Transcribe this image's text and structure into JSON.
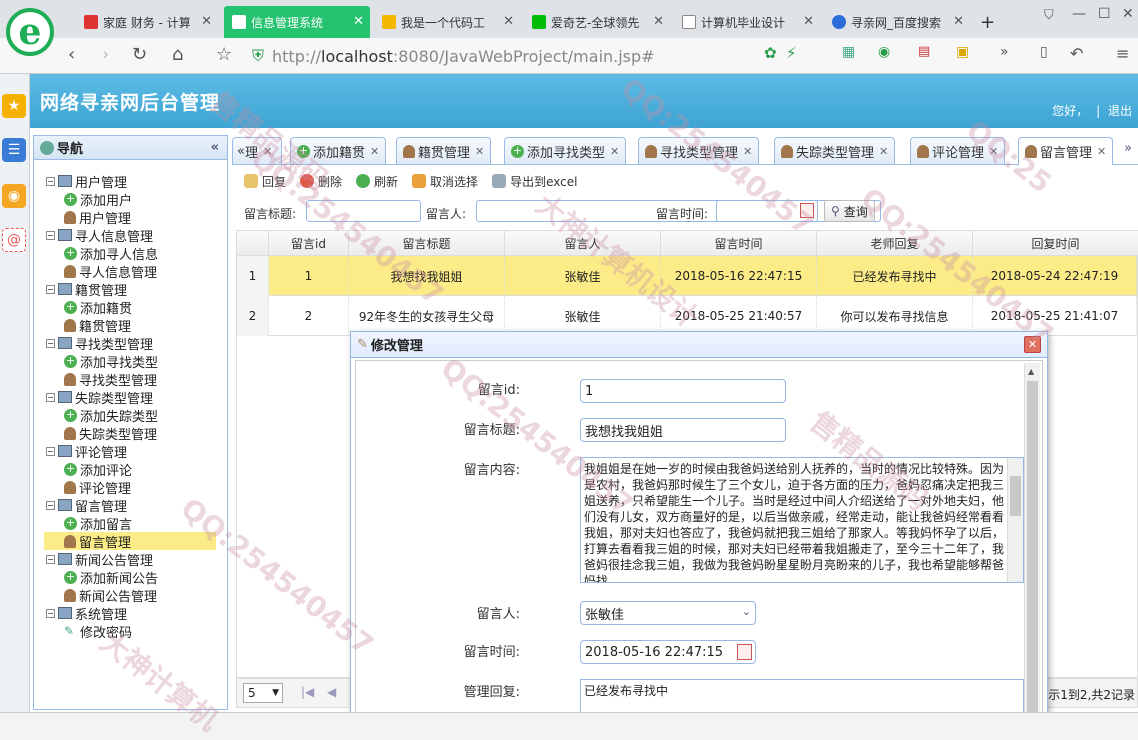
{
  "browser": {
    "tabs": [
      {
        "label": "家庭 财务 - 计算",
        "color": "#d33"
      },
      {
        "label": "信息管理系统",
        "color": "#fff"
      },
      {
        "label": "我是一个代码工",
        "color": "#f5b800"
      },
      {
        "label": "爱奇艺-全球领先",
        "color": "#00be06"
      },
      {
        "label": "计算机毕业设计",
        "color": "#888"
      },
      {
        "label": "寻亲网_百度搜索",
        "color": "#2a6dd8"
      }
    ],
    "new_tab": "+",
    "url_prefix": "http://",
    "url_host": "localhost",
    "url_rest": ":8080/JavaWebProject/main.jsp#"
  },
  "app": {
    "title": "网络寻亲网后台管理",
    "welcome": "您好，",
    "logout": "退出",
    "separator": "|"
  },
  "nav": {
    "title": "导航",
    "collapse": "«",
    "items": [
      {
        "label": "用户管理",
        "type": "folder"
      },
      {
        "label": "添加用户",
        "type": "add"
      },
      {
        "label": "用户管理",
        "type": "user"
      },
      {
        "label": "寻人信息管理",
        "type": "folder"
      },
      {
        "label": "添加寻人信息",
        "type": "add"
      },
      {
        "label": "寻人信息管理",
        "type": "user"
      },
      {
        "label": "籍贯管理",
        "type": "folder"
      },
      {
        "label": "添加籍贯",
        "type": "add"
      },
      {
        "label": "籍贯管理",
        "type": "user"
      },
      {
        "label": "寻找类型管理",
        "type": "folder"
      },
      {
        "label": "添加寻找类型",
        "type": "add"
      },
      {
        "label": "寻找类型管理",
        "type": "user"
      },
      {
        "label": "失踪类型管理",
        "type": "folder"
      },
      {
        "label": "添加失踪类型",
        "type": "add"
      },
      {
        "label": "失踪类型管理",
        "type": "user"
      },
      {
        "label": "评论管理",
        "type": "folder"
      },
      {
        "label": "添加评论",
        "type": "add"
      },
      {
        "label": "评论管理",
        "type": "user"
      },
      {
        "label": "留言管理",
        "type": "folder"
      },
      {
        "label": "添加留言",
        "type": "add"
      },
      {
        "label": "留言管理",
        "type": "user",
        "selected": true
      },
      {
        "label": "新闻公告管理",
        "type": "folder"
      },
      {
        "label": "添加新闻公告",
        "type": "add"
      },
      {
        "label": "新闻公告管理",
        "type": "user"
      },
      {
        "label": "系统管理",
        "type": "folder"
      },
      {
        "label": "修改密码",
        "type": "pen"
      }
    ]
  },
  "content_tabs": [
    "理",
    "添加籍贯",
    "籍贯管理",
    "添加寻找类型",
    "寻找类型管理",
    "失踪类型管理",
    "评论管理",
    "留言管理"
  ],
  "tab_nav": {
    "prev": "«",
    "next": "»"
  },
  "toolbar": {
    "reply": "回复",
    "delete": "删除",
    "refresh": "刷新",
    "unselect": "取消选择",
    "export": "导出到excel"
  },
  "search": {
    "title_label": "留言标题:",
    "person_label": "留言人:",
    "time_label": "留言时间:",
    "query": "查询"
  },
  "grid": {
    "headers": [
      "留言id",
      "留言标题",
      "留言人",
      "留言时间",
      "老师回复",
      "回复时间"
    ],
    "rows": [
      {
        "num": "1",
        "id": "1",
        "title": "我想找我姐姐",
        "person": "张敏佳",
        "time": "2018-05-16 22:47:15",
        "reply": "已经发布寻找中",
        "reply_time": "2018-05-24 22:47:19"
      },
      {
        "num": "2",
        "id": "2",
        "title": "92年冬生的女孩寻生父母",
        "person": "张敏佳",
        "time": "2018-05-25 21:40:57",
        "reply": "你可以发布寻找信息",
        "reply_time": "2018-05-25 21:41:07"
      }
    ],
    "page_size": "5",
    "pager_info": "显示1到2,共2记录"
  },
  "dialog": {
    "title": "修改管理",
    "close": "✕",
    "id_label": "留言id:",
    "id_value": "1",
    "title_label": "留言标题:",
    "title_value": "我想找我姐姐",
    "content_label": "留言内容:",
    "content_value": "我姐姐是在她一岁的时候由我爸妈送给别人抚养的，当时的情况比较特殊。因为是农村，我爸妈那时候生了三个女儿，迫于各方面的压力，爸妈忍痛决定把我三姐送养，只希望能生一个儿子。当时是经过中间人介绍送给了一对外地夫妇，他们没有儿女，双方商量好的是，以后当做亲戚，经常走动，能让我爸妈经常看看我姐，那对夫妇也答应了，我爸妈就把我三姐给了那家人。等我妈怀孕了以后，打算去看看我三姐的时候，那对夫妇已经带着我姐搬走了，至今三十二年了，我爸妈很挂念我三姐，我做为我爸妈盼星星盼月亮盼来的儿子，我也希望能够帮爸妈找",
    "person_label": "留言人:",
    "person_value": "张敏佳",
    "time_label": "留言时间:",
    "time_value": "2018-05-16 22:47:15",
    "reply_label": "管理回复:",
    "reply_value": "已经发布寻找中"
  },
  "watermarks": [
    "QQ:254540457",
    "大神计算机设计",
    "售精品源码",
    "QQ:25",
    "大神计算机"
  ]
}
